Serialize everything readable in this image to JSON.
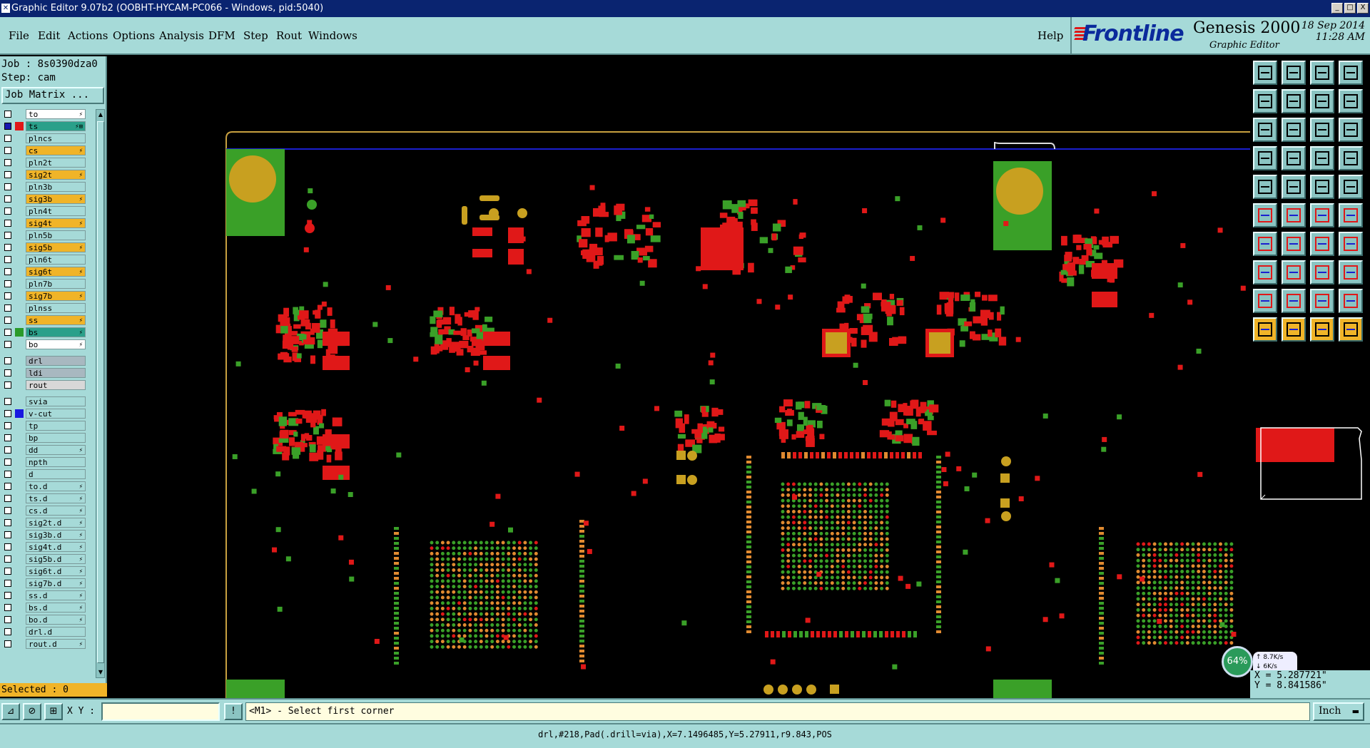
{
  "window": {
    "title": "Graphic Editor 9.07b2 (OOBHT-HYCAM-PC066 - Windows, pid:5040)",
    "controls": [
      "_",
      "□",
      "X"
    ]
  },
  "menu": {
    "items": [
      "File",
      "Edit",
      "Actions",
      "Options",
      "Analysis",
      "DFM",
      "Step",
      "Rout",
      "Windows"
    ],
    "help": "Help"
  },
  "brand": {
    "logo": "Frontline",
    "product": "Genesis 2000",
    "subtitle": "Graphic Editor",
    "date": "18 Sep 2014",
    "time": "11:28 AM"
  },
  "job": {
    "job_label": "Job : 8s0390dza0",
    "step_label": "Step: cam",
    "matrix_button": "Job Matrix ..."
  },
  "layers": [
    {
      "name": "to",
      "bg": "#ffffff",
      "swatch": "",
      "flag": "⚡"
    },
    {
      "name": "ts",
      "bg": "#2aa08a",
      "swatch": "#e01818",
      "flag": "⚡⊞",
      "active": true
    },
    {
      "name": "plncs",
      "bg": "#a6dad8",
      "swatch": "",
      "flag": ""
    },
    {
      "name": "cs",
      "bg": "#f0b428",
      "swatch": "",
      "flag": "⚡"
    },
    {
      "name": "pln2t",
      "bg": "#a6dad8",
      "swatch": "",
      "flag": ""
    },
    {
      "name": "sig2t",
      "bg": "#f0b428",
      "swatch": "",
      "flag": "⚡"
    },
    {
      "name": "pln3b",
      "bg": "#a6dad8",
      "swatch": "",
      "flag": ""
    },
    {
      "name": "sig3b",
      "bg": "#f0b428",
      "swatch": "",
      "flag": "⚡"
    },
    {
      "name": "pln4t",
      "bg": "#a6dad8",
      "swatch": "",
      "flag": ""
    },
    {
      "name": "sig4t",
      "bg": "#f0b428",
      "swatch": "",
      "flag": "⚡"
    },
    {
      "name": "pln5b",
      "bg": "#a6dad8",
      "swatch": "",
      "flag": ""
    },
    {
      "name": "sig5b",
      "bg": "#f0b428",
      "swatch": "",
      "flag": "⚡"
    },
    {
      "name": "pln6t",
      "bg": "#a6dad8",
      "swatch": "",
      "flag": ""
    },
    {
      "name": "sig6t",
      "bg": "#f0b428",
      "swatch": "",
      "flag": "⚡"
    },
    {
      "name": "pln7b",
      "bg": "#a6dad8",
      "swatch": "",
      "flag": ""
    },
    {
      "name": "sig7b",
      "bg": "#f0b428",
      "swatch": "",
      "flag": "⚡"
    },
    {
      "name": "plnss",
      "bg": "#a6dad8",
      "swatch": "",
      "flag": ""
    },
    {
      "name": "ss",
      "bg": "#f0b428",
      "swatch": "",
      "flag": "⚡"
    },
    {
      "name": "bs",
      "bg": "#2aa08a",
      "swatch": "#2a9a2a",
      "flag": "⚡"
    },
    {
      "name": "bo",
      "bg": "#ffffff",
      "swatch": "",
      "flag": "⚡"
    },
    {
      "name": "drl",
      "bg": "#a8b8c0",
      "swatch": "",
      "flag": ""
    },
    {
      "name": "ldi",
      "bg": "#a8b8c0",
      "swatch": "",
      "flag": ""
    },
    {
      "name": "rout",
      "bg": "#d8d8d8",
      "swatch": "",
      "flag": ""
    },
    {
      "name": "svia",
      "bg": "#a6dad8",
      "swatch": "",
      "flag": ""
    },
    {
      "name": "v-cut",
      "bg": "#a6dad8",
      "swatch": "#1818e0",
      "flag": ""
    },
    {
      "name": "tp",
      "bg": "#a6dad8",
      "swatch": "",
      "flag": ""
    },
    {
      "name": "bp",
      "bg": "#a6dad8",
      "swatch": "",
      "flag": ""
    },
    {
      "name": "dd",
      "bg": "#a6dad8",
      "swatch": "",
      "flag": "⚡"
    },
    {
      "name": "npth",
      "bg": "#a6dad8",
      "swatch": "",
      "flag": ""
    },
    {
      "name": "d",
      "bg": "#a6dad8",
      "swatch": "",
      "flag": ""
    },
    {
      "name": "to.d",
      "bg": "#a6dad8",
      "swatch": "",
      "flag": "⚡"
    },
    {
      "name": "ts.d",
      "bg": "#a6dad8",
      "swatch": "",
      "flag": "⚡"
    },
    {
      "name": "cs.d",
      "bg": "#a6dad8",
      "swatch": "",
      "flag": "⚡"
    },
    {
      "name": "sig2t.d",
      "bg": "#a6dad8",
      "swatch": "",
      "flag": "⚡"
    },
    {
      "name": "sig3b.d",
      "bg": "#a6dad8",
      "swatch": "",
      "flag": "⚡"
    },
    {
      "name": "sig4t.d",
      "bg": "#a6dad8",
      "swatch": "",
      "flag": "⚡"
    },
    {
      "name": "sig5b.d",
      "bg": "#a6dad8",
      "swatch": "",
      "flag": "⚡"
    },
    {
      "name": "sig6t.d",
      "bg": "#a6dad8",
      "swatch": "",
      "flag": "⚡"
    },
    {
      "name": "sig7b.d",
      "bg": "#a6dad8",
      "swatch": "",
      "flag": "⚡"
    },
    {
      "name": "ss.d",
      "bg": "#a6dad8",
      "swatch": "",
      "flag": "⚡"
    },
    {
      "name": "bs.d",
      "bg": "#a6dad8",
      "swatch": "",
      "flag": "⚡"
    },
    {
      "name": "bo.d",
      "bg": "#a6dad8",
      "swatch": "",
      "flag": "⚡"
    },
    {
      "name": "drl.d",
      "bg": "#a6dad8",
      "swatch": "",
      "flag": ""
    },
    {
      "name": "rout.d",
      "bg": "#a6dad8",
      "swatch": "",
      "flag": "⚡"
    }
  ],
  "selection": {
    "label": "Selected : 0"
  },
  "coordinates": {
    "x": "X = 5.287721\"",
    "y": "Y = 8.841586\""
  },
  "network": {
    "percent": "64%",
    "up": "8.7K/s",
    "down": "6K/s"
  },
  "input": {
    "xy_label": "X Y :",
    "xy_value": "",
    "prompt": "<M1> - Select first corner",
    "unit": "Inch"
  },
  "status": {
    "text": "drl,#218,Pad(.drill=via),X=7.1496485,Y=5.27911,r9.843,POS"
  },
  "tool_icons": [
    "layer-up-icon",
    "layer-down-icon",
    "home-icon",
    "split-view-icon",
    "prev-icon",
    "next-icon",
    "redo-icon",
    "snake-icon",
    "fit-icon",
    "zoom-window-icon",
    "scale-icon",
    "help-icon",
    "measure-icon",
    "grid-icon",
    "snap-icon",
    "snap-alt-icon",
    "camera-icon",
    "outline-icon",
    "ruler-icon",
    "pad-icon",
    "net-icon",
    "delete-icon",
    "connect-icon",
    "route-icon",
    "line-icon",
    "slash-icon",
    "arc-icon",
    "text-icon",
    "pad-add-icon",
    "wire-icon",
    "bracket-icon",
    "group-icon",
    "triangle-icon",
    "triangle-alt-icon",
    "arch-icon",
    "arch-alt-icon",
    "pointer-icon",
    "select-icon",
    "move-icon",
    "rotate-icon"
  ],
  "colors": {
    "panel": "#a6dad8",
    "copper_red": "#e01818",
    "copper_green": "#3aa028",
    "gold": "#c8a020",
    "board_outline": "#c8a040",
    "vcut_blue": "#1a20d0"
  }
}
